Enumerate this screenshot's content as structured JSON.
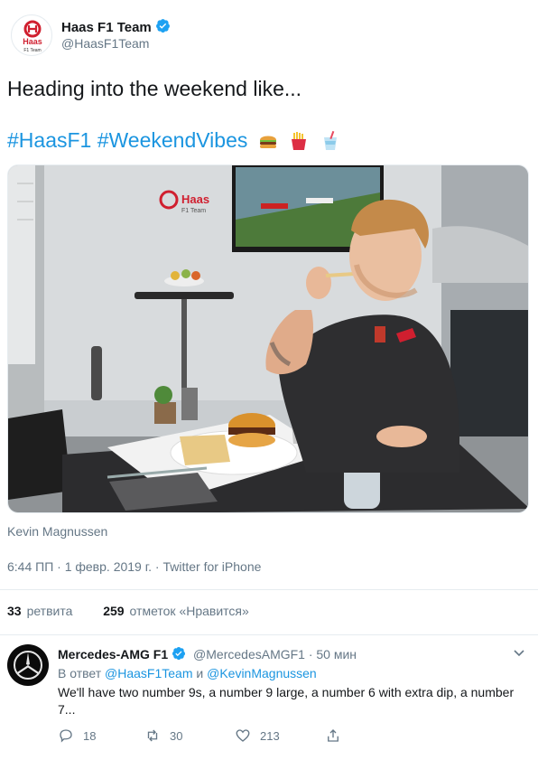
{
  "tweet": {
    "author_name": "Haas F1 Team",
    "author_handle": "@HaasF1Team",
    "avatar_logo_text": "Haas",
    "avatar_logo_subtext": "F1 Team",
    "text": "Heading into the weekend like...",
    "hashtags": "#HaasF1 #WeekendVibes",
    "emojis": [
      "hamburger-emoji",
      "fries-emoji",
      "drink-emoji"
    ],
    "photo_caption": "Kevin Magnussen",
    "photo_logo_text": "Haas",
    "photo_logo_subtext": "F1 Team",
    "meta": "6:44 ПП · 1 февр. 2019 г. · Twitter for iPhone"
  },
  "stats": {
    "retweets_count": "33",
    "retweets_label": "ретвита",
    "likes_count": "259",
    "likes_label": "отметок «Нравится»"
  },
  "reply": {
    "author_name": "Mercedes-AMG F1",
    "author_handle": "@MercedesAMGF1 · 50 мин",
    "reply_prefix": "В ответ",
    "reply_user_1": "@HaasF1Team",
    "reply_conj": "и",
    "reply_user_2": "@KevinMagnussen",
    "text": "We'll have two number 9s, a number 9 large, a number 6 with extra dip, a number 7...",
    "replies_count": "18",
    "retweets_count": "30",
    "likes_count": "213"
  },
  "colors": {
    "link": "#1b95e0",
    "secondary_text": "#657786",
    "primary_text": "#14171a",
    "divider": "#e6ecf0",
    "verified": "#1da1f2",
    "haas_red": "#d01f2f"
  }
}
